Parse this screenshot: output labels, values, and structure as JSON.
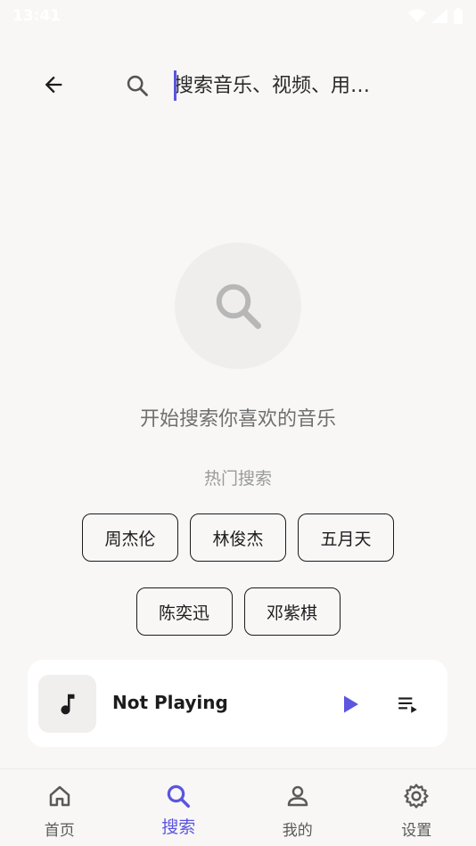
{
  "status_bar": {
    "time": "13:41"
  },
  "search": {
    "placeholder": "搜索音乐、视频、用…"
  },
  "empty_state": {
    "message": "开始搜索你喜欢的音乐"
  },
  "hot_search": {
    "title": "热门搜索",
    "rows": [
      [
        "周杰伦",
        "林俊杰",
        "五月天"
      ],
      [
        "陈奕迅",
        "邓紫棋"
      ]
    ]
  },
  "player": {
    "title": "Not Playing"
  },
  "nav": {
    "items": [
      {
        "label": "首页",
        "icon": "home-icon"
      },
      {
        "label": "搜索",
        "icon": "search-icon",
        "active": true
      },
      {
        "label": "我的",
        "icon": "person-icon"
      },
      {
        "label": "设置",
        "icon": "gear-icon"
      }
    ]
  },
  "colors": {
    "accent": "#5b55e0",
    "background": "#f8f7f6",
    "text": "#1c1c1e"
  }
}
